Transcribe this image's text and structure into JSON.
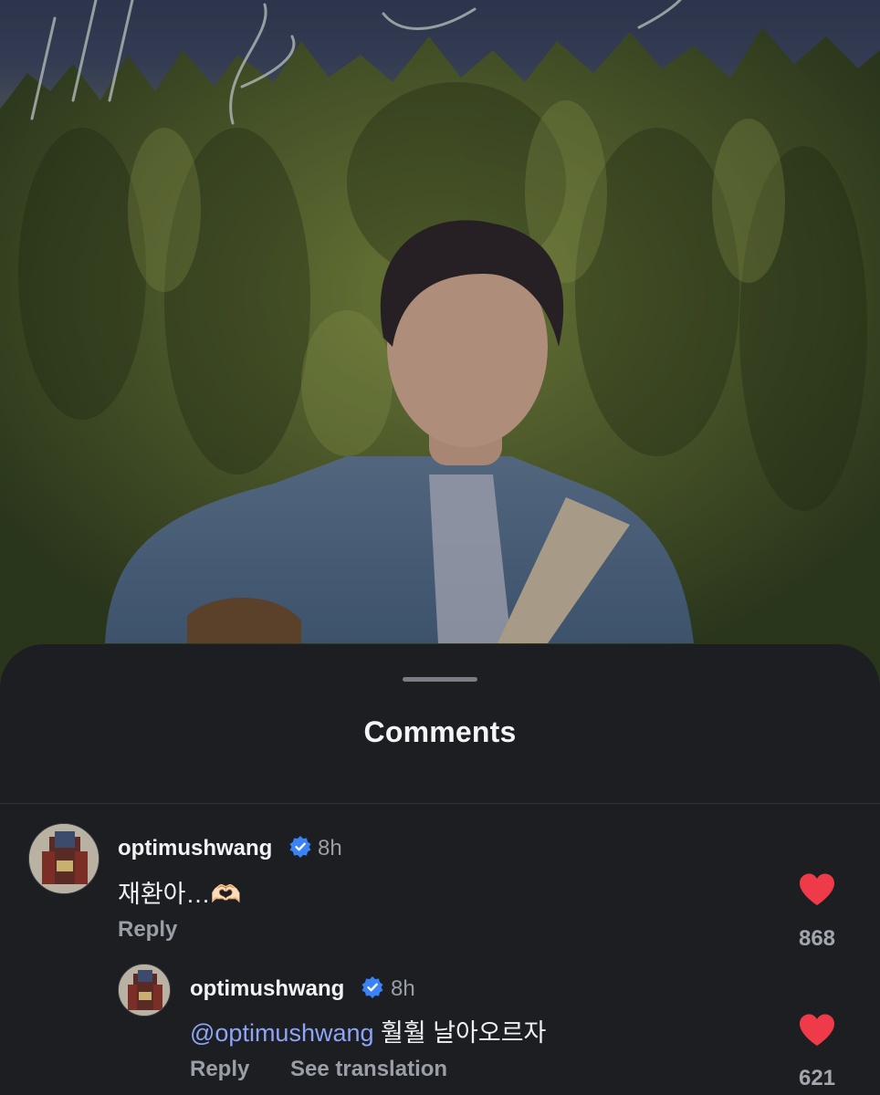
{
  "sheet": {
    "title": "Comments"
  },
  "comments": [
    {
      "username": "optimushwang",
      "verified": true,
      "time": "8h",
      "text": "재환아…🫶🏻",
      "reply_label": "Reply",
      "likes": "868",
      "liked": true
    },
    {
      "username": "optimushwang",
      "verified": true,
      "time": "8h",
      "mention": "@optimushwang",
      "text": " 훨훨 날아오르자",
      "reply_label": "Reply",
      "translate_label": "See translation",
      "likes": "621",
      "liked": true
    }
  ],
  "colors": {
    "sheet_bg": "#1c1e22",
    "heart": "#ef3b49",
    "mention": "#8ea4f5",
    "verified": "#3b82f6"
  }
}
